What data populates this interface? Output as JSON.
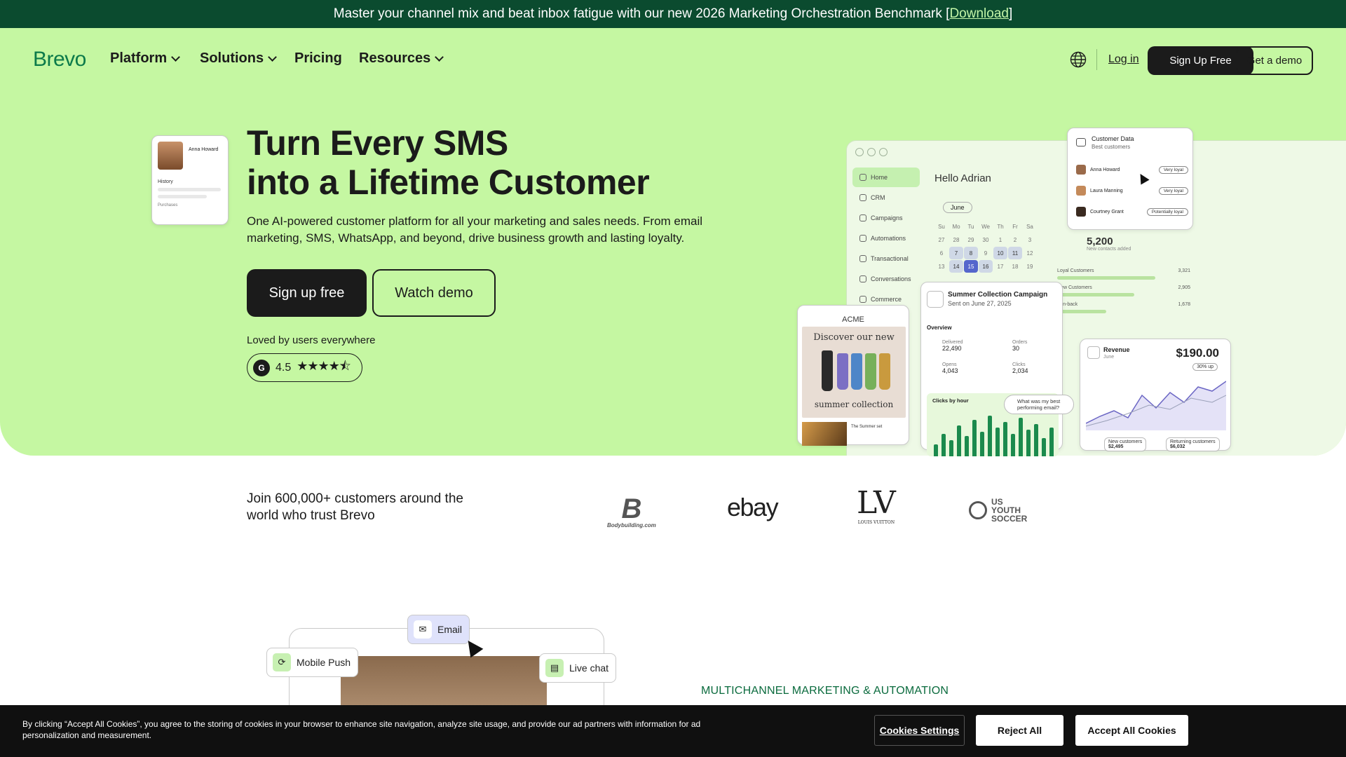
{
  "banner": {
    "text": "Master your channel mix and beat inbox fatigue with our new 2026 Marketing Orchestration Benchmark [",
    "link": "Download",
    "close_bracket": "]"
  },
  "nav": {
    "logo": "Brevo",
    "items": [
      {
        "label": "Platform",
        "has_dropdown": true
      },
      {
        "label": "Solutions",
        "has_dropdown": true
      },
      {
        "label": "Pricing",
        "has_dropdown": false
      },
      {
        "label": "Resources",
        "has_dropdown": true
      }
    ],
    "login": "Log in",
    "signup": "Sign Up Free",
    "demo": "Get a demo"
  },
  "hero": {
    "title_line1": "Turn Every SMS",
    "title_line2": "into a Lifetime Customer",
    "subtitle": "One AI-powered customer platform for all your marketing and sales needs. From email marketing, SMS, WhatsApp, and beyond, drive business growth and lasting loyalty.",
    "cta_primary": "Sign up free",
    "cta_secondary": "Watch demo",
    "loved": "Loved by users everywhere",
    "rating_badge": "G",
    "rating": "4.5",
    "stars": "★★★★⯪"
  },
  "mockup": {
    "sidebar": [
      "Home",
      "CRM",
      "Campaigns",
      "Automations",
      "Transactional",
      "Conversations",
      "Commerce"
    ],
    "greeting": "Hello Adrian",
    "calendar_month": "June",
    "calendar_days": [
      "Su",
      "Mo",
      "Tu",
      "We",
      "Th",
      "Fr",
      "Sa"
    ],
    "calendar_dates": [
      "27",
      "28",
      "29",
      "30",
      "1",
      "2",
      "3",
      "6",
      "7",
      "8",
      "9",
      "10",
      "11",
      "12",
      "13",
      "14",
      "15",
      "16",
      "17",
      "18",
      "19"
    ],
    "profile": {
      "name": "Anna Howard",
      "history": "History",
      "purchases": "Purchases"
    },
    "customer_data": {
      "title": "Customer Data",
      "subtitle": "Best customers",
      "rows": [
        {
          "name": "Anna Howard",
          "tag": "Very loyal"
        },
        {
          "name": "Laura Manning",
          "tag": "Very loyal"
        },
        {
          "name": "Courtney Grant",
          "tag": "Potentially loyal"
        }
      ]
    },
    "contacts": {
      "value": "5,200",
      "label": "New contacts added"
    },
    "segments": [
      {
        "label": "Loyal Customers",
        "value": "3,321"
      },
      {
        "label": "New Customers",
        "value": "2,905"
      },
      {
        "label": "Win-back",
        "value": "1,678"
      }
    ],
    "email": {
      "brand": "ACME",
      "headline": "Discover our new",
      "tagline": "summer collection",
      "product": "The Summer set"
    },
    "campaign": {
      "title": "Summer Collection Campaign",
      "sent": "Sent on June 27, 2025",
      "overview": "Overview",
      "stats": [
        {
          "label": "Delivered",
          "value": "22,490"
        },
        {
          "label": "Orders",
          "value": "30"
        },
        {
          "label": "Opens",
          "value": "4,043"
        },
        {
          "label": "Clicks",
          "value": "2,034"
        }
      ],
      "chart_label": "Clicks by hour",
      "hour_bars": [
        0.3,
        0.55,
        0.4,
        0.75,
        0.5,
        0.9,
        0.6,
        1.0,
        0.7,
        0.85,
        0.55,
        0.95,
        0.65,
        0.8,
        0.45,
        0.7
      ]
    },
    "ai_prompt": "What was my best performing email?",
    "revenue": {
      "title": "Revenue",
      "period": "June",
      "value": "$190.00",
      "change": "30% up",
      "legend_new": "New customers",
      "legend_new_value": "$2,495",
      "legend_returning": "Returning customers",
      "legend_returning_value": "$6,032"
    }
  },
  "customers": {
    "text": "Join 600,000+ customers around the world who trust Brevo",
    "logos": [
      "Bodybuilding.com",
      "ebay",
      "LOUIS VUITTON",
      "US YOUTH SOCCER"
    ]
  },
  "multichannel": {
    "channels": [
      "Mobile Push",
      "Email",
      "Live chat"
    ],
    "eyebrow": "MULTICHANNEL MARKETING & AUTOMATION"
  },
  "cookie": {
    "text": "By clicking “Accept All Cookies”, you agree to the storing of cookies in your browser to enhance site navigation, analyze site usage, and provide our ad partners with information for ad personalization and measurement.",
    "settings": "Cookies Settings",
    "reject": "Reject All",
    "accept": "Accept All Cookies"
  },
  "colors": {
    "banner_bg": "#0b4b2f",
    "hero_bg": "#c5f7a2",
    "brand_green": "#0c7a4a",
    "dark": "#1b1b1b"
  }
}
